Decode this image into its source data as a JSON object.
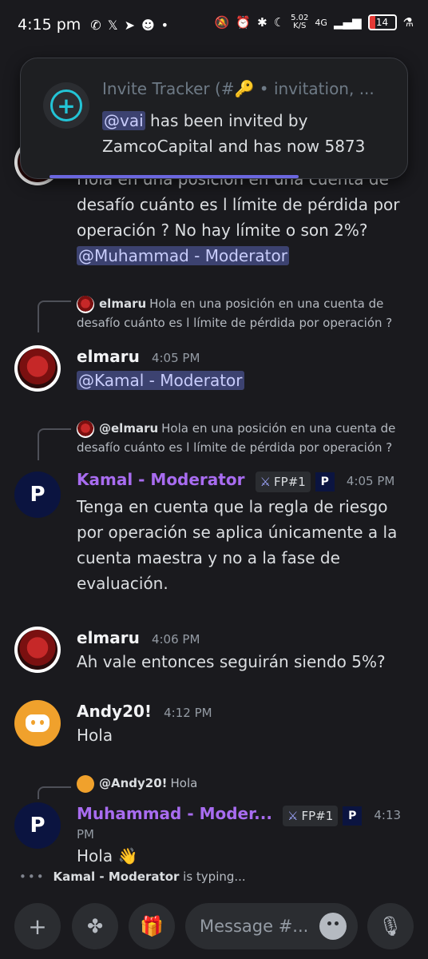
{
  "status_bar": {
    "time": "4:15 pm",
    "net_speed_value": "5.02",
    "net_speed_unit": "K/S",
    "network": "4G",
    "battery": "14"
  },
  "toast": {
    "title": "Invite Tracker (#🔑 • invitation, ...",
    "mention": "@vai",
    "body_text": " has been invited by ZamcoCapital and has now 5873"
  },
  "messages": {
    "m0": {
      "text": "Hola en una posición en una cuenta de desafío cuánto es l límite de pérdida por operación ? No hay límite o son 2%?",
      "mention": "@Muhammad - Moderator"
    },
    "m1": {
      "reply_author": "elmaru",
      "reply_text": "Hola en una posición en una cuenta de desafío cuánto es l límite de pérdida por operación ?",
      "author": "elmaru",
      "timestamp": "4:05 PM",
      "mention": "@Kamal - Moderator"
    },
    "m2": {
      "reply_author": "@elmaru",
      "reply_text": "Hola en una posición en una cuenta de desafío cuánto es l límite de pérdida por operación ?",
      "author": "Kamal - Moderator",
      "badge": "FP#1",
      "timestamp": "4:05 PM",
      "text": "Tenga en cuenta que la regla de riesgo por operación se aplica únicamente a la cuenta maestra y no a la fase de evaluación."
    },
    "m3": {
      "author": "elmaru",
      "timestamp": "4:06 PM",
      "text": "Ah vale entonces seguirán siendo 5%?"
    },
    "m4": {
      "author": "Andy20!",
      "timestamp": "4:12 PM",
      "text": "Hola"
    },
    "m5": {
      "reply_author": "@Andy20!",
      "reply_text": "Hola",
      "author": "Muhammad - Moder...",
      "badge": "FP#1",
      "timestamp": "4:13 PM",
      "text": "Hola 👋"
    }
  },
  "typing": {
    "user": "Kamal - Moderator",
    "suffix": " is typing..."
  },
  "composer": {
    "placeholder": "Message #..."
  },
  "colors": {
    "background": "#1a1a1e",
    "moderator_name": "#a86cf0",
    "mention_bg": "#3c4270",
    "accent_cyan": "#23c4d6"
  }
}
